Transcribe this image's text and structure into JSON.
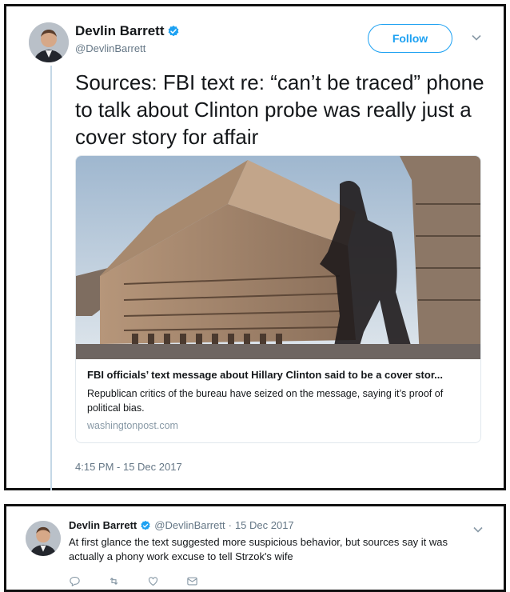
{
  "tweet": {
    "author": {
      "name": "Devlin Barrett",
      "handle": "@DevlinBarrett",
      "verified": true
    },
    "follow_label": "Follow",
    "menu_icon": "chevron-down-icon",
    "text": "Sources: FBI text re: “can’t be traced” phone to talk about Clinton probe was really just a cover story for affair",
    "card": {
      "title": "FBI officials’ text message about Hillary Clinton said to be a cover stor...",
      "description": "Republican critics of the bureau have seized on the message, saying it’s proof of political bias.",
      "domain": "washingtonpost.com"
    },
    "timestamp": "4:15 PM - 15 Dec 2017"
  },
  "reply": {
    "author": {
      "name": "Devlin Barrett",
      "handle": "@DevlinBarrett",
      "verified": true
    },
    "separator": "·",
    "date": "15 Dec 2017",
    "text": "At first glance the text suggested more suspicious behavior, but sources say it was actually a phony work excuse to tell Strzok's wife",
    "actions": [
      "reply-icon",
      "retweet-icon",
      "like-icon",
      "message-icon"
    ]
  },
  "colors": {
    "accent": "#1da1f2",
    "secondary_text": "#657786",
    "thread_line": "#c4d7e6"
  }
}
